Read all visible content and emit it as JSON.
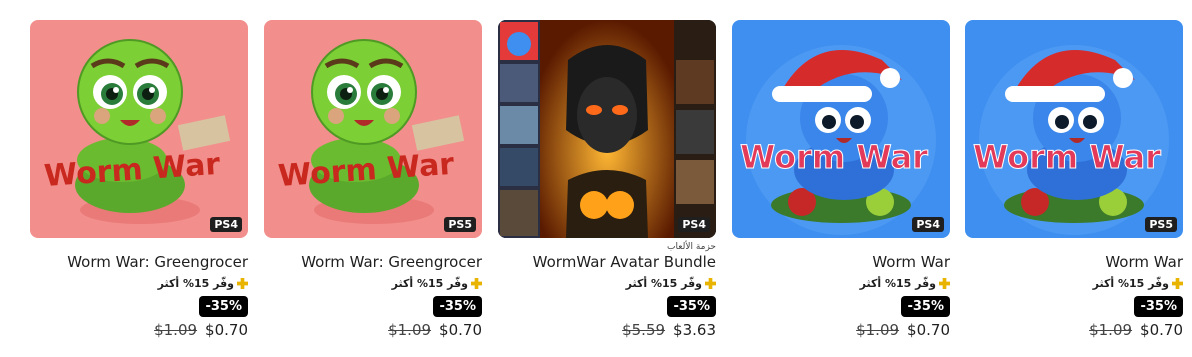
{
  "products": [
    {
      "title": "Worm War",
      "platform": "PS5",
      "kind": "",
      "offer": "وفّر 15% أكثر",
      "discount": "-35%",
      "old_price": "$1.09",
      "new_price": "$0.70",
      "art": "blue-worm"
    },
    {
      "title": "Worm War",
      "platform": "PS4",
      "kind": "",
      "offer": "وفّر 15% أكثر",
      "discount": "-35%",
      "old_price": "$1.09",
      "new_price": "$0.70",
      "art": "blue-worm"
    },
    {
      "title": "WormWar Avatar Bundle",
      "platform": "PS4",
      "kind": "حزمة الألعاب",
      "offer": "وفّر 15% أكثر",
      "discount": "-35%",
      "old_price": "$5.59",
      "new_price": "$3.63",
      "art": "avatar-bundle"
    },
    {
      "title": "Worm War: Greengrocer",
      "platform": "PS5",
      "kind": "",
      "offer": "وفّر 15% أكثر",
      "discount": "-35%",
      "old_price": "$1.09",
      "new_price": "$0.70",
      "art": "green-worm"
    },
    {
      "title": "Worm War: Greengrocer",
      "platform": "PS4",
      "kind": "",
      "offer": "وفّر 15% أكثر",
      "discount": "-35%",
      "old_price": "$1.09",
      "new_price": "$0.70",
      "art": "green-worm"
    }
  ],
  "colors": {
    "plus_gold": "#e8b400",
    "badge_bg": "#000000",
    "blue_bg": "#3f8ff0",
    "pink_bg": "#f28e8c"
  }
}
